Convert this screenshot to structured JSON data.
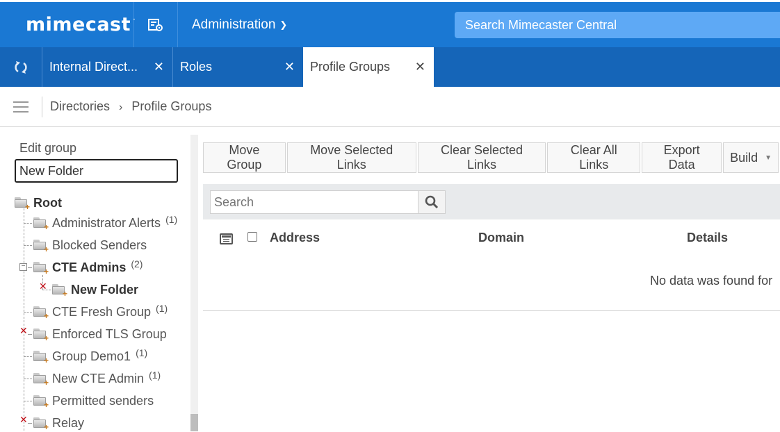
{
  "header": {
    "logo": "mimecast",
    "logo_suffix": "·",
    "admin_menu": "Administration",
    "search_placeholder": "Search Mimecaster Central"
  },
  "tabs": [
    {
      "label": "Internal Direct...",
      "close": "✕"
    },
    {
      "label": "Roles",
      "close": "✕"
    },
    {
      "label": "Profile Groups",
      "close": "✕",
      "active": true
    }
  ],
  "breadcrumb": {
    "root": "Directories",
    "separator": "›",
    "current": "Profile Groups"
  },
  "edit_group": {
    "label": "Edit group",
    "value": "New Folder"
  },
  "tree": {
    "root": "Root",
    "nodes": [
      {
        "name": "Administrator Alerts",
        "count": "(1)"
      },
      {
        "name": "Blocked Senders",
        "count": ""
      },
      {
        "name": "CTE Admins",
        "count": "(2)"
      },
      {
        "name": "New Folder",
        "count": ""
      },
      {
        "name": "CTE Fresh Group",
        "count": "(1)"
      },
      {
        "name": "Enforced TLS Group",
        "count": ""
      },
      {
        "name": "Group Demo1",
        "count": "(1)"
      },
      {
        "name": "New CTE Admin",
        "count": "(1)"
      },
      {
        "name": "Permitted senders",
        "count": ""
      },
      {
        "name": "Relay",
        "count": ""
      }
    ]
  },
  "toolbar": {
    "move_group": "Move Group",
    "move_selected_links": "Move Selected Links",
    "clear_selected_links": "Clear Selected Links",
    "clear_all_links": "Clear All Links",
    "export_data": "Export Data",
    "build": "Build"
  },
  "search": {
    "placeholder": "Search"
  },
  "table": {
    "columns": [
      "Address",
      "Domain",
      "Details"
    ],
    "empty_text": "No data was found for"
  },
  "colors": {
    "header_blue": "#1a78d3",
    "tab_blue": "#1565b8",
    "search_blue": "#5ea9f5",
    "delete_red": "#c0111a"
  }
}
